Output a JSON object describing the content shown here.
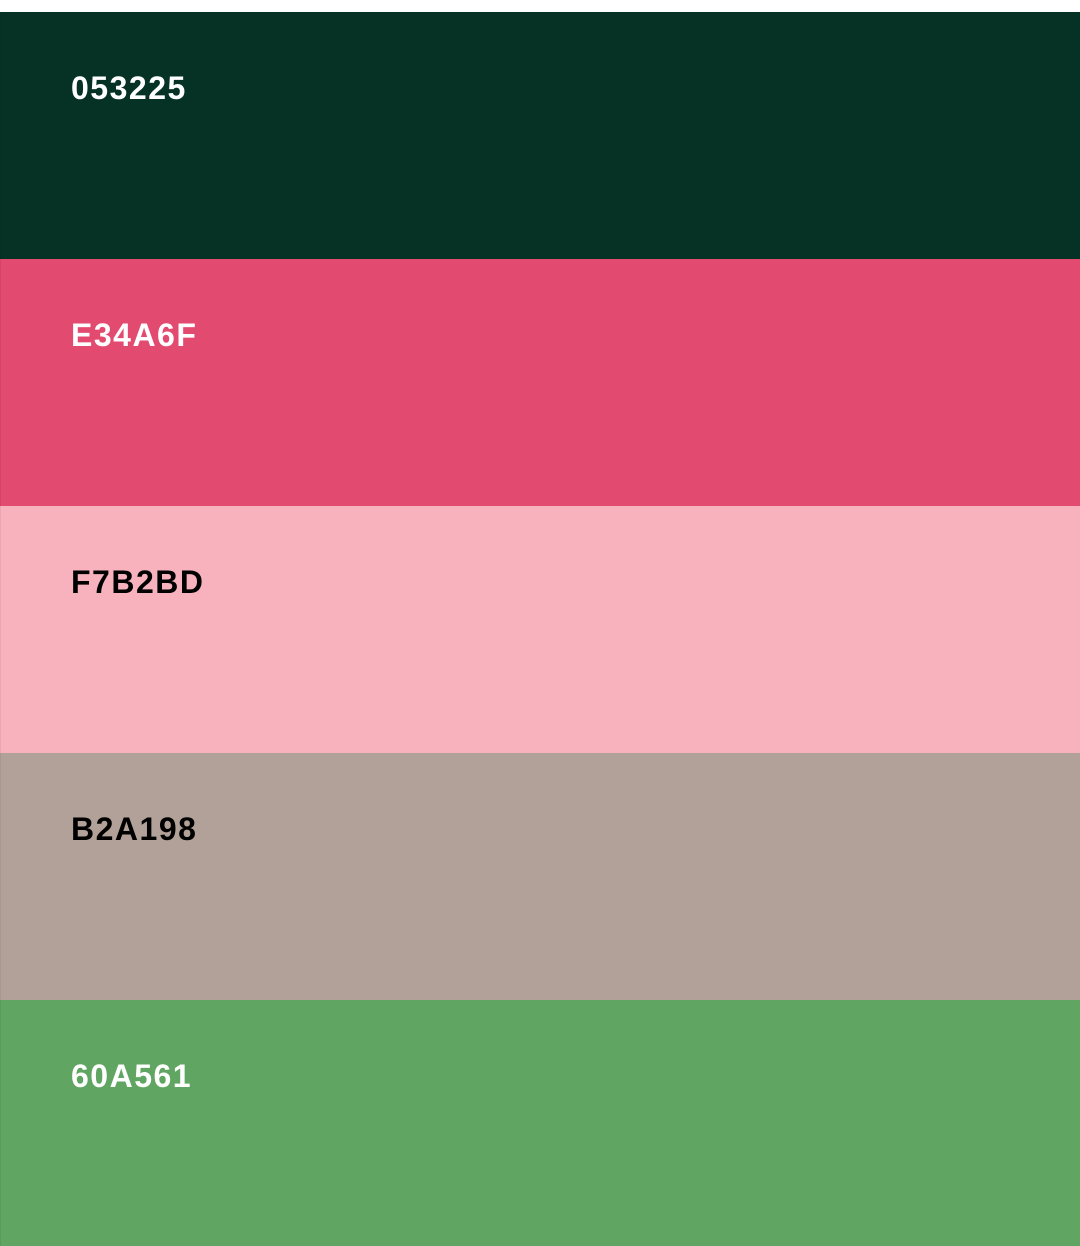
{
  "palette": {
    "swatches": [
      {
        "hex": "053225",
        "color": "#053225",
        "text_color": "#ffffff"
      },
      {
        "hex": "E34A6F",
        "color": "#E34A6F",
        "text_color": "#ffffff"
      },
      {
        "hex": "F7B2BD",
        "color": "#F7B2BD",
        "text_color": "#000000"
      },
      {
        "hex": "B2A198",
        "color": "#B2A198",
        "text_color": "#000000"
      },
      {
        "hex": "60A561",
        "color": "#60A561",
        "text_color": "#ffffff"
      }
    ]
  }
}
